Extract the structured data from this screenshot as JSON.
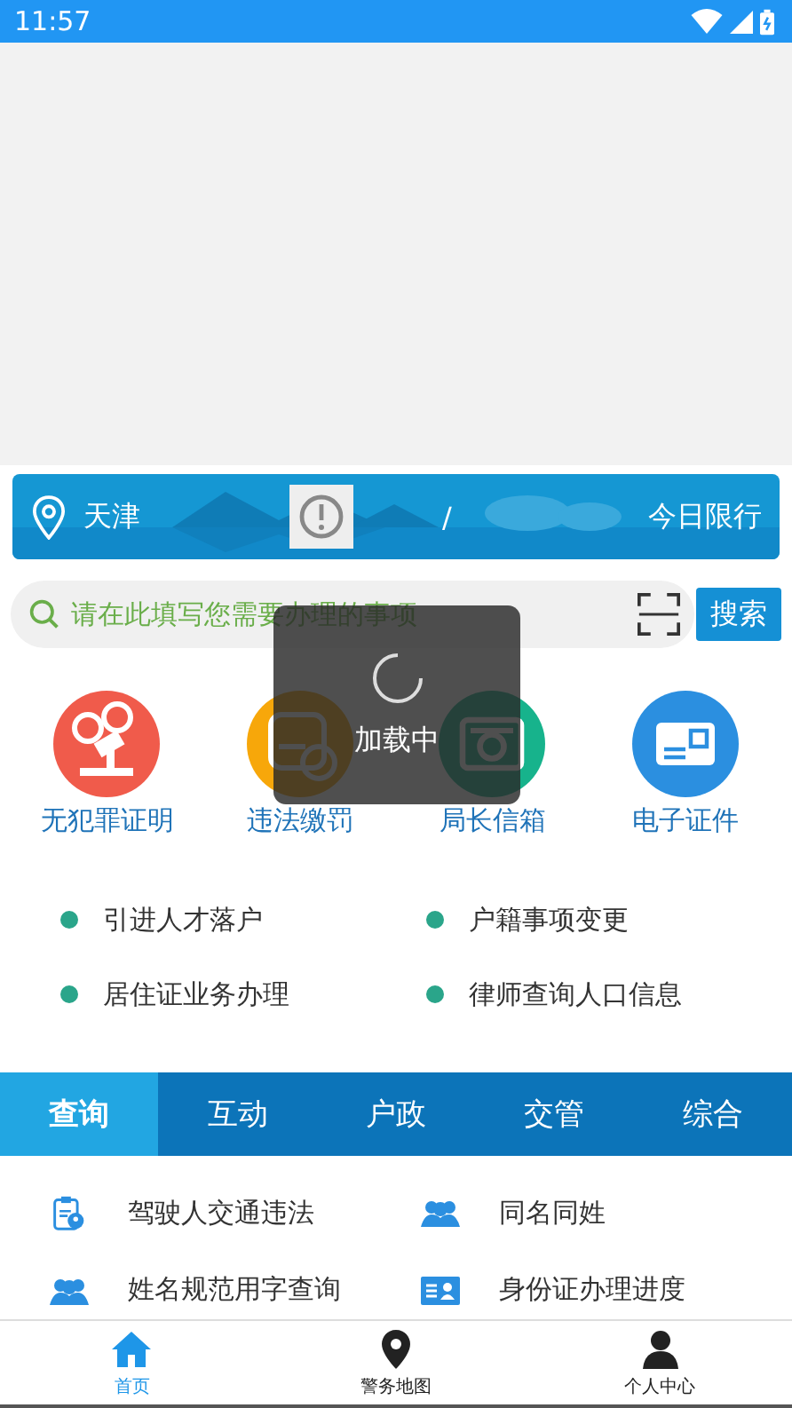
{
  "status_bar": {
    "time": "11:57"
  },
  "banner": {
    "city": "天津",
    "separator": "/",
    "link": "今日限行"
  },
  "search": {
    "placeholder": "请在此填写您需要办理的事项",
    "button": "搜索"
  },
  "services": [
    {
      "label": "无犯罪证明",
      "kind": "gavel",
      "color": "#f05b4b"
    },
    {
      "label": "违法缴罚",
      "kind": "truck",
      "color": "#f7a70a"
    },
    {
      "label": "局长信箱",
      "kind": "camera",
      "color": "#17b38c"
    },
    {
      "label": "电子证件",
      "kind": "card",
      "color": "#2b8fe0"
    }
  ],
  "links": [
    {
      "label": "引进人才落户"
    },
    {
      "label": "户籍事项变更"
    },
    {
      "label": "居住证业务办理"
    },
    {
      "label": "律师查询人口信息"
    }
  ],
  "tabs": [
    {
      "label": "查询",
      "selected": true
    },
    {
      "label": "互动",
      "selected": false
    },
    {
      "label": "户政",
      "selected": false
    },
    {
      "label": "交管",
      "selected": false
    },
    {
      "label": "综合",
      "selected": false
    }
  ],
  "queries": [
    {
      "label": "驾驶人交通违法",
      "kind": "clipboard"
    },
    {
      "label": "同名同姓",
      "kind": "people"
    },
    {
      "label": "姓名规范用字查询",
      "kind": "people"
    },
    {
      "label": "身份证办理进度",
      "kind": "idcard"
    }
  ],
  "nav": [
    {
      "label": "首页",
      "kind": "home",
      "selected": true
    },
    {
      "label": "警务地图",
      "kind": "pin",
      "selected": false
    },
    {
      "label": "个人中心",
      "kind": "person",
      "selected": false
    }
  ],
  "loading": {
    "text": "加载中"
  }
}
